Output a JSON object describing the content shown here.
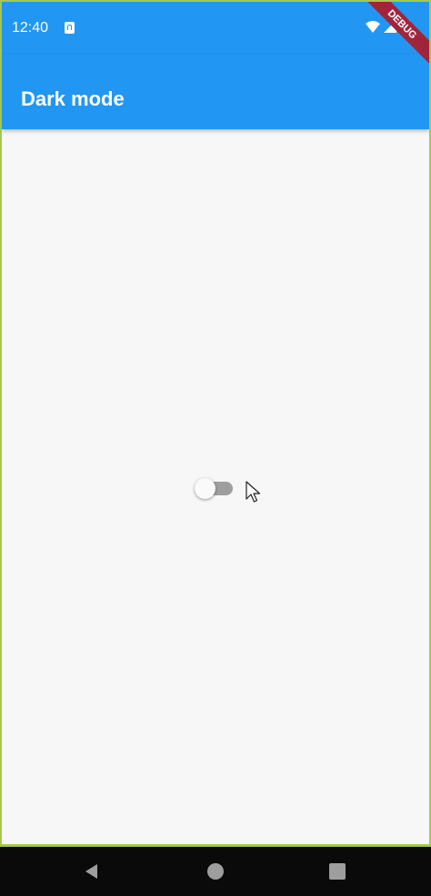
{
  "status_bar": {
    "time": "12:40",
    "notification_icon": "text-a-icon",
    "icons": [
      "wifi-icon",
      "signal-icon",
      "battery-icon"
    ]
  },
  "debug_banner": {
    "label": "DEBUG"
  },
  "app_bar": {
    "title": "Dark mode",
    "color": "#2196f3"
  },
  "main": {
    "dark_mode_switch": {
      "on": false
    }
  },
  "nav_bar": {
    "buttons": [
      "back-icon",
      "home-icon",
      "recents-icon"
    ]
  }
}
